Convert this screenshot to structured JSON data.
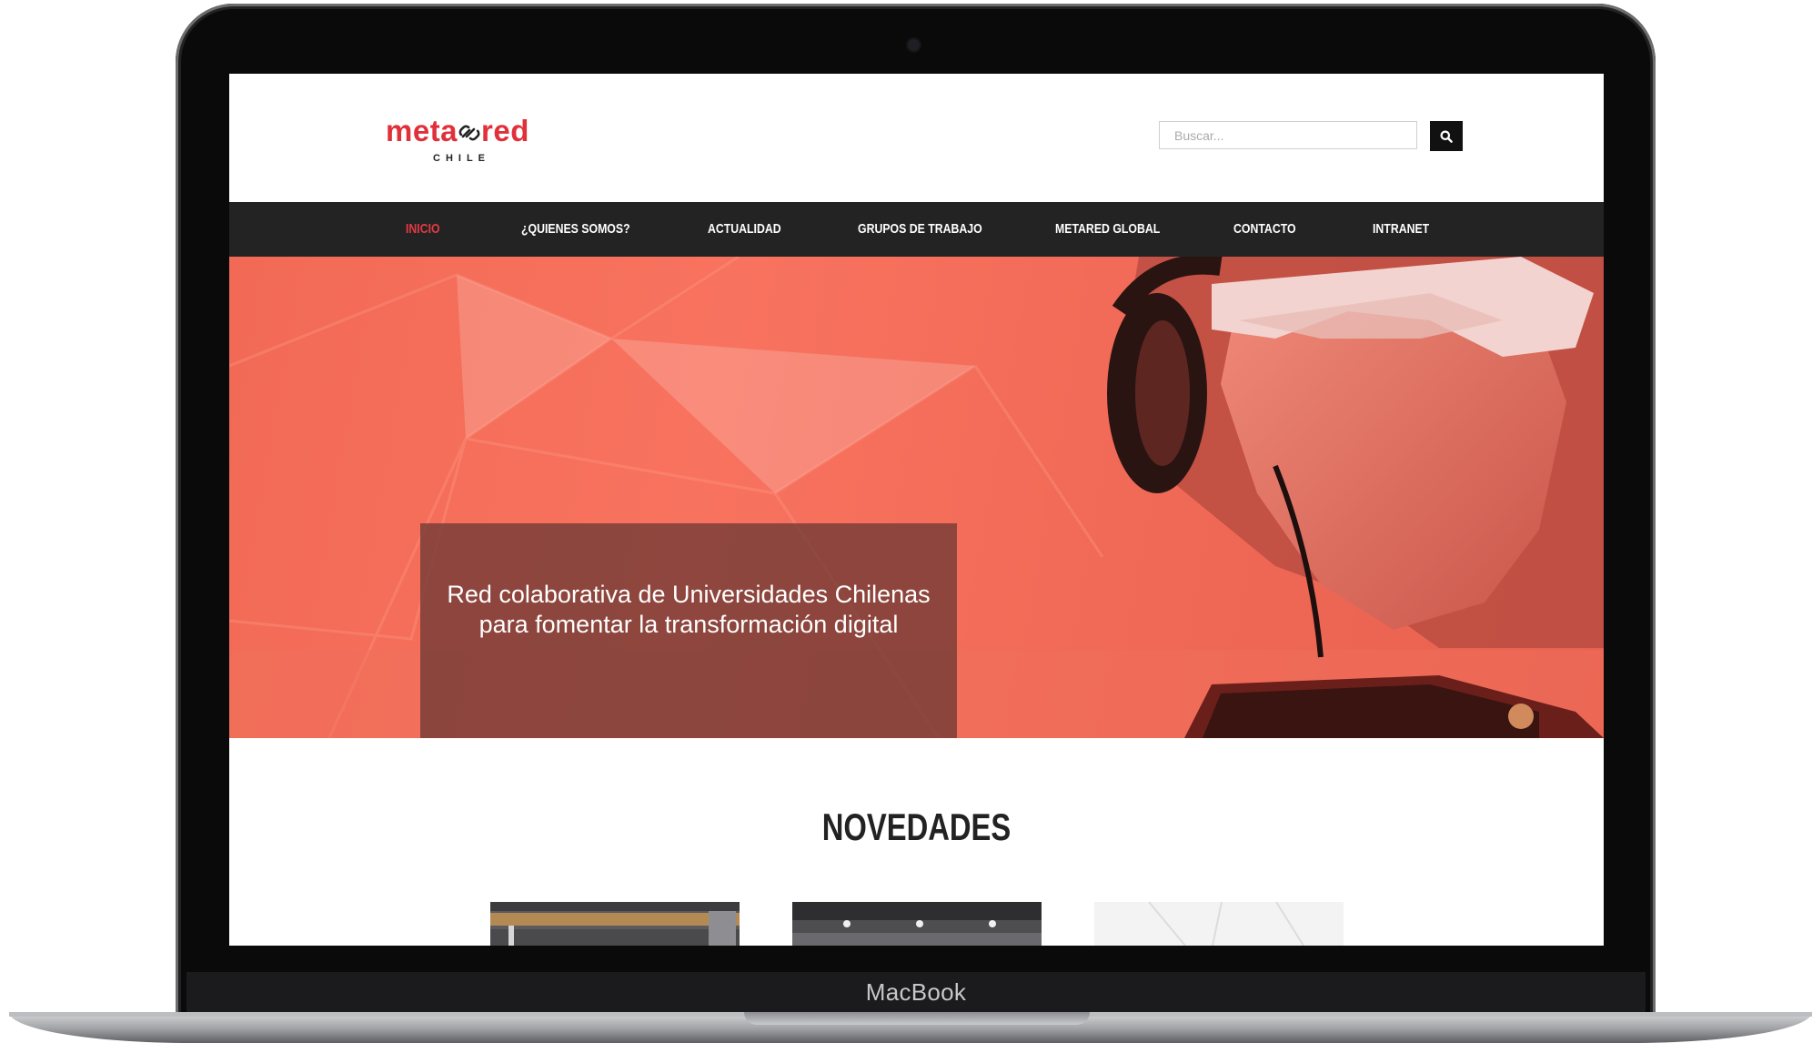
{
  "device": {
    "brand_label": "MacBook"
  },
  "site": {
    "logo": {
      "word_left": "meta",
      "word_right": "red",
      "subtitle": "CHILE",
      "link_icon": "chain-link-icon"
    },
    "search": {
      "placeholder": "Buscar...",
      "button_icon": "search-icon"
    },
    "nav": {
      "items": [
        {
          "label": "INICIO",
          "active": true
        },
        {
          "label": "¿QUIENES SOMOS?",
          "active": false
        },
        {
          "label": "ACTUALIDAD",
          "active": false
        },
        {
          "label": "GRUPOS DE TRABAJO",
          "active": false
        },
        {
          "label": "METARED GLOBAL",
          "active": false
        },
        {
          "label": "CONTACTO",
          "active": false
        },
        {
          "label": "INTRANET",
          "active": false
        }
      ]
    },
    "hero": {
      "caption": "Red colaborativa de Universidades Chilenas para fomentar la transformación digital"
    },
    "news": {
      "title": "NOVEDADES",
      "thumbnails": 3
    }
  },
  "colors": {
    "brand_red": "#e0303a",
    "nav_background": "#232323",
    "nav_active": "#e33a43",
    "hero_coral": "#f26a55"
  }
}
